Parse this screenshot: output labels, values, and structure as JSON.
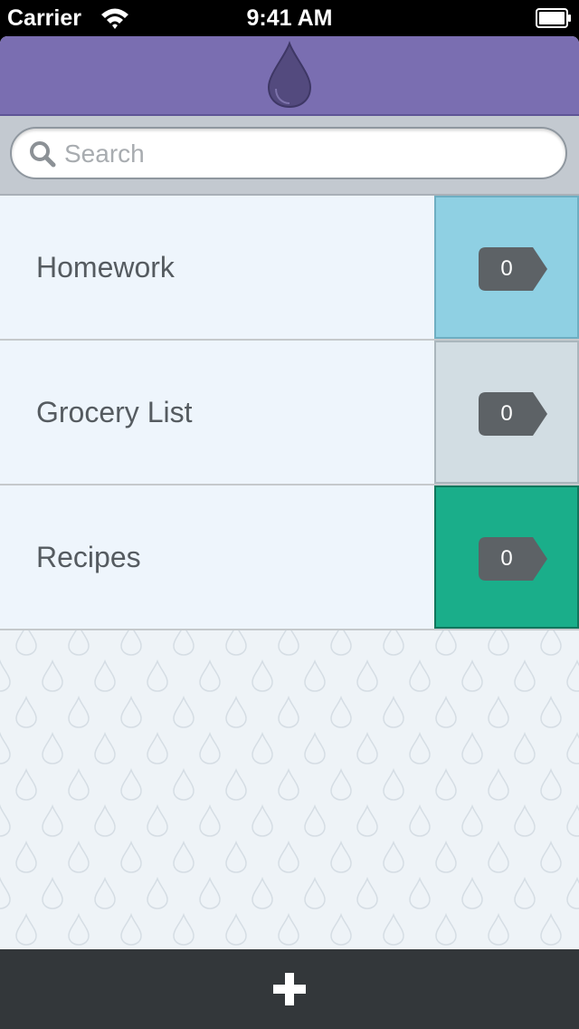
{
  "status_bar": {
    "carrier": "Carrier",
    "time": "9:41 AM",
    "wifi_icon": "wifi-icon",
    "battery_icon": "battery-icon"
  },
  "header": {
    "logo_icon": "drop-logo-icon",
    "color": "#7a6eb1"
  },
  "search": {
    "placeholder": "Search",
    "value": "",
    "icon": "search-icon"
  },
  "lists": [
    {
      "label": "Homework",
      "count": "0",
      "color": "#8fd0e3"
    },
    {
      "label": "Grocery List",
      "count": "0",
      "color": "#d2dde3"
    },
    {
      "label": "Recipes",
      "count": "0",
      "color": "#1aae8a"
    }
  ],
  "toolbar": {
    "add_icon": "plus-icon",
    "color": "#33373a"
  }
}
